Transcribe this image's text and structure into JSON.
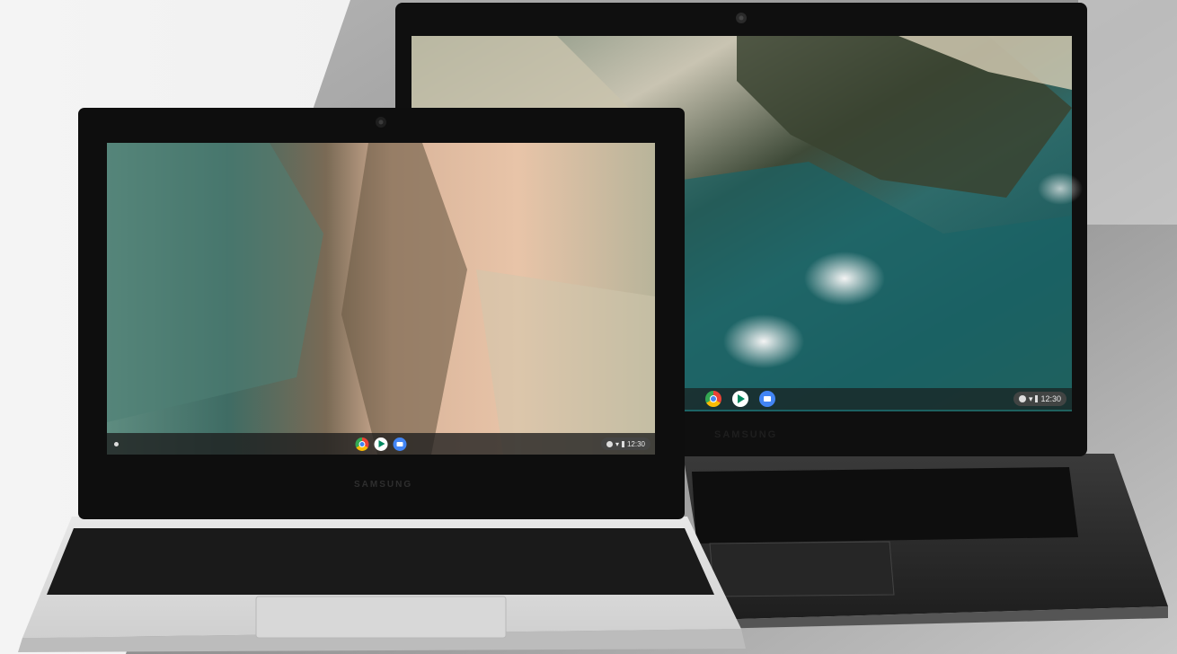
{
  "front_laptop": {
    "brand": "SAMSUNG",
    "shelf_time": "12:30",
    "shelf_apps": [
      "chrome-icon",
      "play-store-icon",
      "files-icon"
    ]
  },
  "back_laptop": {
    "brand": "SAMSUNG",
    "shelf_time": "12:30",
    "shelf_apps": [
      "chrome-icon",
      "play-store-icon",
      "files-icon"
    ]
  },
  "colors": {
    "background_light": "#f2f2f2",
    "background_grey": "#9a9a9a",
    "bezel": "#111111",
    "silver_deck": "#dcdcdc",
    "dark_deck": "#2b2b2b"
  }
}
